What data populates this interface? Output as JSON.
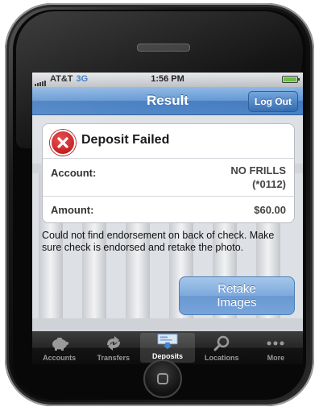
{
  "status_bar": {
    "carrier": "AT&T",
    "network": "3G",
    "time": "1:56 PM"
  },
  "nav_bar": {
    "title": "Result",
    "logout_label": "Log Out"
  },
  "result_card": {
    "title": "Deposit Failed",
    "icon": "error-x-icon",
    "rows": [
      {
        "label": "Account:",
        "value_line1": "NO FRILLS",
        "value_line2": "(*0112)"
      },
      {
        "label": "Amount:",
        "value_line1": "$60.00"
      }
    ]
  },
  "message": "Could not find endorsement on back of check. Make sure check is endorsed and retake the photo.",
  "retake_button": {
    "line1": "Retake",
    "line2": "Images"
  },
  "tab_bar": {
    "tabs": [
      {
        "label": "Accounts",
        "icon": "piggy-bank-icon"
      },
      {
        "label": "Transfers",
        "icon": "transfer-arrows-icon"
      },
      {
        "label": "Deposits",
        "icon": "deposit-check-icon",
        "active": true
      },
      {
        "label": "Locations",
        "icon": "magnifier-icon"
      },
      {
        "label": "More",
        "icon": "more-dots-icon"
      }
    ]
  },
  "colors": {
    "nav_blue": "#4a82c6",
    "error_red": "#c51f1f",
    "button_blue": "#7da9dc"
  }
}
